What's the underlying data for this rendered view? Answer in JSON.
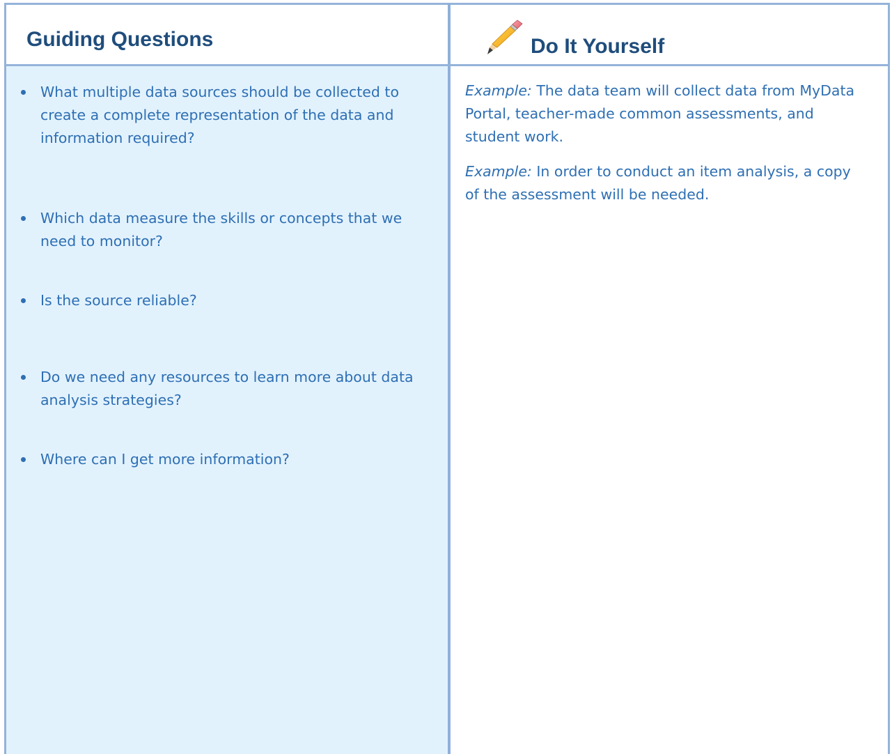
{
  "left_header": {
    "title": "Guiding Questions"
  },
  "right_header": {
    "title": "Do It Yourself",
    "icon": "pencil-icon"
  },
  "questions": [
    "What multiple data sources should be collected to create a complete representation of the data and information required?",
    "Which data measure the skills or concepts that we need to monitor?",
    "Is the source reliable?",
    "Do we need any resources to learn more about data analysis strategies?",
    "Where can I get more information?"
  ],
  "examples": [
    {
      "label": "Example:",
      "text": " The data team will collect data from MyData Portal, teacher-made common assessments, and student work."
    },
    {
      "label": "Example:",
      "text": " In order to conduct an item analysis, a copy of the assessment will be needed."
    }
  ],
  "colors": {
    "border": "#94b3d9",
    "left_fill": "#e2f2fd",
    "header_text": "#1f4d7c",
    "body_text": "#2e6fb3"
  }
}
